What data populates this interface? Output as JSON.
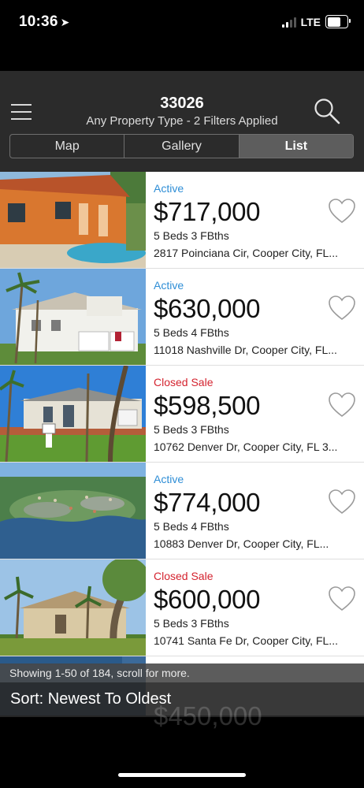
{
  "status_bar": {
    "time": "10:36",
    "network": "LTE"
  },
  "header": {
    "title": "33026",
    "subtitle": "Any Property Type - 2 Filters Applied",
    "tabs": [
      {
        "label": "Map"
      },
      {
        "label": "Gallery"
      },
      {
        "label": "List"
      }
    ],
    "active_tab": "List"
  },
  "listings": [
    {
      "status": "Active",
      "status_kind": "active",
      "price": "$717,000",
      "beds": "5 Beds 3 FBths",
      "address": "2817 Poinciana Cir, Cooper City, FL..."
    },
    {
      "status": "Active",
      "status_kind": "active",
      "price": "$630,000",
      "beds": "5 Beds 4 FBths",
      "address": "11018 Nashville Dr, Cooper City, FL..."
    },
    {
      "status": "Closed Sale",
      "status_kind": "closed",
      "price": "$598,500",
      "beds": "5 Beds 3 FBths",
      "address": "10762 Denver Dr, Cooper City, FL 3..."
    },
    {
      "status": "Active",
      "status_kind": "active",
      "price": "$774,000",
      "beds": "5 Beds 4 FBths",
      "address": "10883 Denver Dr, Cooper City, FL..."
    },
    {
      "status": "Closed Sale",
      "status_kind": "closed",
      "price": "$600,000",
      "beds": "5 Beds 3 FBths",
      "address": "10741 Santa Fe Dr, Cooper City, FL..."
    }
  ],
  "partial_listing": {
    "price": "$450,000"
  },
  "footer": {
    "showing": "Showing 1-50 of 184, scroll for more.",
    "sort": "Sort: Newest To Oldest"
  },
  "colors": {
    "active": "#2f8ed6",
    "closed": "#d4232f",
    "header_bg": "#2b2b2b"
  }
}
